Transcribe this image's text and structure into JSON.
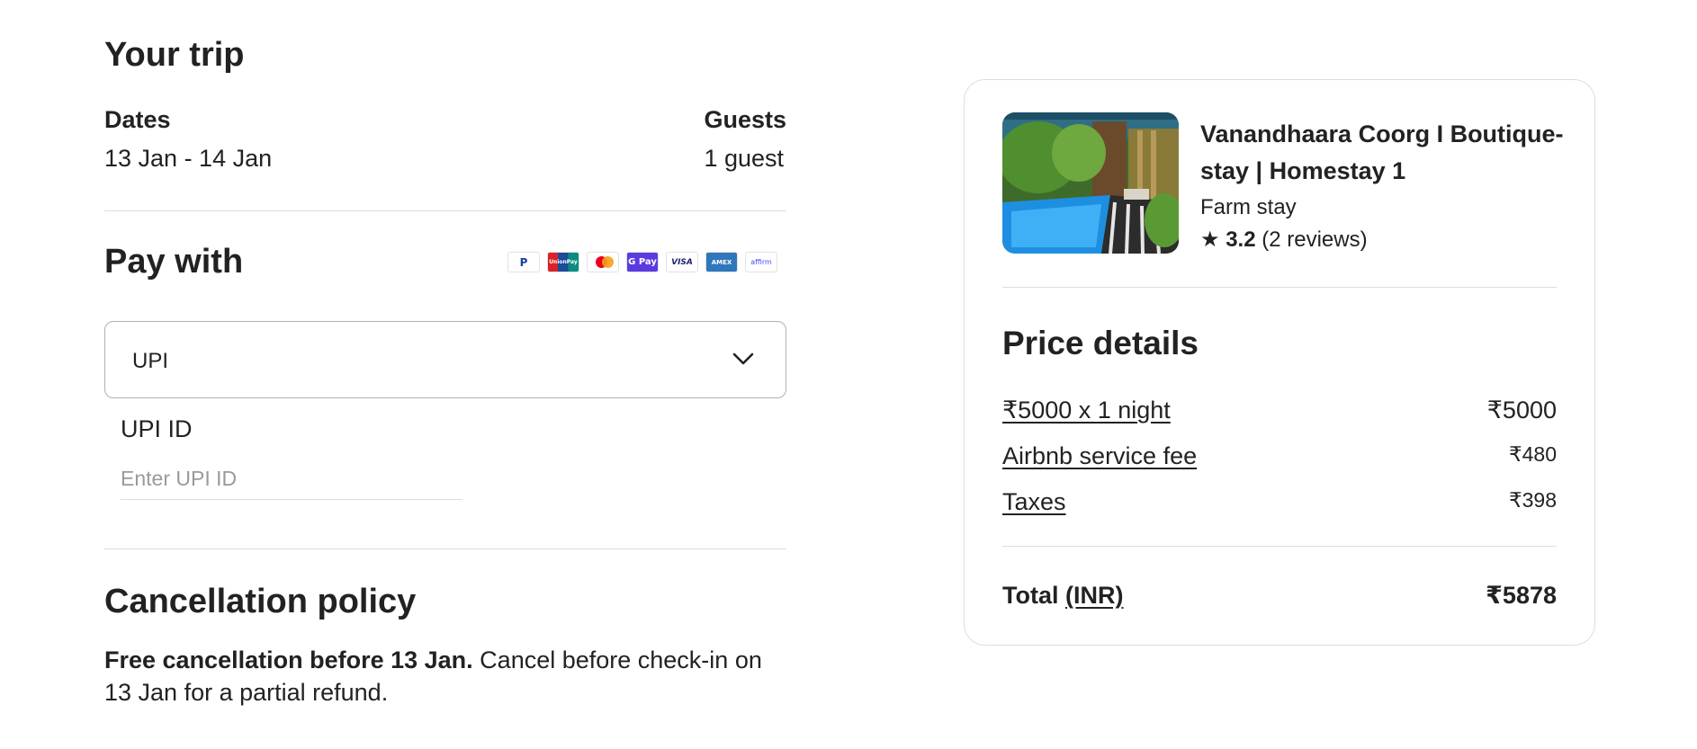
{
  "trip": {
    "heading": "Your trip",
    "dates_label": "Dates",
    "dates_value": "13 Jan - 14 Jan",
    "guests_label": "Guests",
    "guests_value": "1 guest"
  },
  "pay": {
    "heading": "Pay with",
    "card_icons": [
      "paypal-icon",
      "unionpay-icon",
      "mastercard-icon",
      "gpay-icon",
      "visa-icon",
      "amex-icon",
      "affirm-icon"
    ],
    "card_texts": {
      "paypal": "P",
      "unionpay": "UnionPay",
      "gpay": "G Pay",
      "visa": "VISA",
      "amex": "AMEX",
      "affirm": "affirm"
    },
    "method_selected": "UPI",
    "upi_label": "UPI ID",
    "upi_value": "",
    "upi_placeholder": "Enter UPI ID"
  },
  "cancellation": {
    "heading": "Cancellation policy",
    "bold_text": "Free cancellation before 13 Jan.",
    "text": " Cancel before check-in on 13 Jan for a partial refund."
  },
  "listing": {
    "title": "Vanandhaara Coorg I Boutique-stay | Homestay 1",
    "type": "Farm stay",
    "rating_star": "★",
    "rating": "3.2",
    "reviews": "(2 reviews)"
  },
  "price": {
    "heading": "Price details",
    "items": [
      {
        "label": "₹5000 x 1 night",
        "amount": "₹5000"
      },
      {
        "label": "Airbnb service fee",
        "amount": "₹480"
      },
      {
        "label": "Taxes",
        "amount": "₹398"
      }
    ],
    "total_label": "Total",
    "total_currency": "(INR)",
    "total_amount": "₹5878"
  },
  "colors": {
    "text": "#222222",
    "divider": "#dddddd",
    "placeholder": "#9a9a9a"
  }
}
